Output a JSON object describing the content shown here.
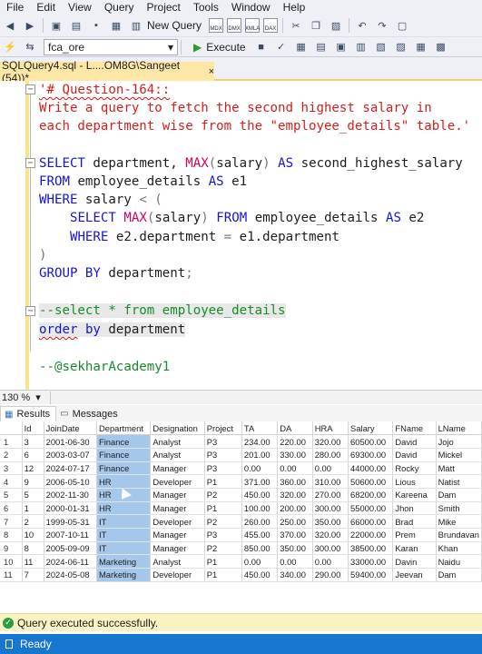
{
  "menu": [
    "File",
    "Edit",
    "View",
    "Query",
    "Project",
    "Tools",
    "Window",
    "Help"
  ],
  "toolbar": {
    "new_query_label": "New Query",
    "database": "fca_ore",
    "execute_label": "Execute"
  },
  "tab": {
    "title": "SQLQuery4.sql - L....OM8G\\Sangeet (54))*",
    "close": "×"
  },
  "editor": {
    "comment_open": "'# Question-164::",
    "comment_line1": "Write a query to fetch the second highest salary in",
    "comment_line2": "each department wise from the \"employee_details\" table.'",
    "sql": {
      "l1_select": "SELECT",
      "l1_col": " department, ",
      "l1_max": "MAX",
      "l1_arg": "(salary) ",
      "l1_as": "AS",
      "l1_alias": " second_highest_salary",
      "l2_from": "FROM",
      "l2_tbl": " employee_details ",
      "l2_as": "AS",
      "l2_alias": " e1",
      "l3_where": "WHERE",
      "l3_rest": " salary ",
      "l3_op": "< (",
      "l4_select": "SELECT",
      "l4_max": "MAX",
      "l4_arg": "(salary) ",
      "l4_from": "FROM",
      "l4_tbl": " employee_details ",
      "l4_as": "AS",
      "l4_alias": " e2",
      "l5_where": "WHERE",
      "l5_rest": " e2.department ",
      "l5_eq": "=",
      "l5_rest2": " e1.department",
      "l6_close": ")",
      "l7_group": "GROUP BY",
      "l7_rest": " department",
      "l7_semi": ";"
    },
    "comment_select": "--select * from employee_details",
    "order_kw": "order",
    "order_by": "by",
    "order_rest": " department",
    "footer_comment": "--@sekharAcademy1"
  },
  "zoom": "130 %",
  "results_tabs": {
    "results": "Results",
    "messages": "Messages"
  },
  "results": {
    "columns": [
      "Id",
      "JoinDate",
      "Department",
      "Designation",
      "Project",
      "TA",
      "DA",
      "HRA",
      "Salary",
      "FName",
      "LName"
    ],
    "rows": [
      {
        "n": "1",
        "cells": [
          "3",
          "2001-06-30",
          "Finance",
          "Analyst",
          "P3",
          "234.00",
          "220.00",
          "320.00",
          "60500.00",
          "David",
          "Jojo"
        ]
      },
      {
        "n": "2",
        "cells": [
          "6",
          "2003-03-07",
          "Finance",
          "Analyst",
          "P3",
          "201.00",
          "330.00",
          "280.00",
          "69300.00",
          "David",
          "Mickel"
        ]
      },
      {
        "n": "3",
        "cells": [
          "12",
          "2024-07-17",
          "Finance",
          "Manager",
          "P3",
          "0.00",
          "0.00",
          "0.00",
          "44000.00",
          "Rocky",
          "Matt"
        ]
      },
      {
        "n": "4",
        "cells": [
          "9",
          "2006-05-10",
          "HR",
          "Developer",
          "P1",
          "371.00",
          "360.00",
          "310.00",
          "50600.00",
          "Lious",
          "Natist"
        ]
      },
      {
        "n": "5",
        "cells": [
          "5",
          "2002-11-30",
          "HR",
          "Manager",
          "P2",
          "450.00",
          "320.00",
          "270.00",
          "68200.00",
          "Kareena",
          "Dam"
        ]
      },
      {
        "n": "6",
        "cells": [
          "1",
          "2000-01-31",
          "HR",
          "Manager",
          "P1",
          "100.00",
          "200.00",
          "300.00",
          "55000.00",
          "Jhon",
          "Smith"
        ]
      },
      {
        "n": "7",
        "cells": [
          "2",
          "1999-05-31",
          "IT",
          "Developer",
          "P2",
          "260.00",
          "250.00",
          "350.00",
          "66000.00",
          "Brad",
          "Mike"
        ]
      },
      {
        "n": "8",
        "cells": [
          "10",
          "2007-10-11",
          "IT",
          "Manager",
          "P3",
          "455.00",
          "370.00",
          "320.00",
          "22000.00",
          "Prem",
          "Brundavan"
        ]
      },
      {
        "n": "9",
        "cells": [
          "8",
          "2005-09-09",
          "IT",
          "Manager",
          "P2",
          "850.00",
          "350.00",
          "300.00",
          "38500.00",
          "Karan",
          "Khan"
        ]
      },
      {
        "n": "10",
        "cells": [
          "11",
          "2024-06-11",
          "Marketing",
          "Analyst",
          "P1",
          "0.00",
          "0.00",
          "0.00",
          "33000.00",
          "Davin",
          "Naidu"
        ]
      },
      {
        "n": "11",
        "cells": [
          "7",
          "2024-05-08",
          "Marketing",
          "Developer",
          "P1",
          "450.00",
          "340.00",
          "290.00",
          "59400.00",
          "Jeevan",
          "Dam"
        ]
      }
    ]
  },
  "status": {
    "message": "Query executed successfully.",
    "ready": "Ready"
  }
}
